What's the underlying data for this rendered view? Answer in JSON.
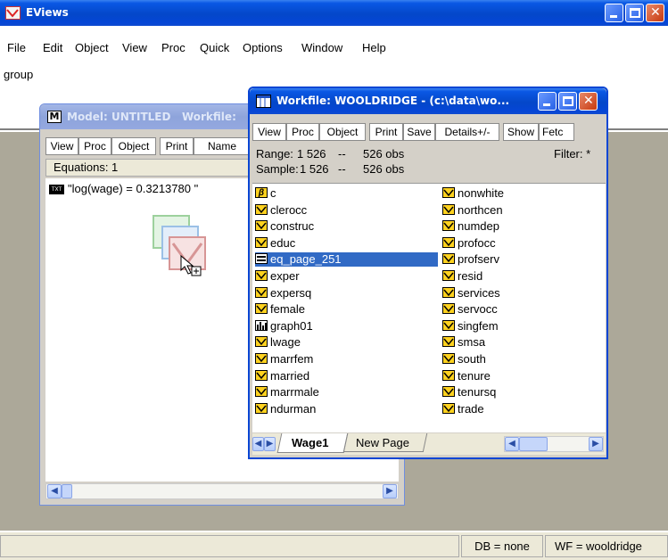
{
  "app": {
    "title": "EViews",
    "menu": [
      "File",
      "Edit",
      "Object",
      "View",
      "Proc",
      "Quick",
      "Options",
      "Window",
      "Help"
    ],
    "command_text": "group",
    "status": {
      "db": "DB = none",
      "wf": "WF = wooldridge"
    }
  },
  "model_window": {
    "title": "Model: UNTITLED   Workfile:",
    "toolbar": [
      "View",
      "Proc",
      "Object",
      "Print",
      "Name"
    ],
    "equations_label": "Equations: 1",
    "equation_text": "\"log(wage) = 0.3213780 \"",
    "equation_badge": "TXT"
  },
  "workfile_window": {
    "title": "Workfile: WOOLDRIDGE - (c:\\data\\wo...",
    "toolbar": [
      "View",
      "Proc",
      "Object",
      "Print",
      "Save",
      "Details+/-",
      "Show",
      "Fetc"
    ],
    "range_label": "Range:",
    "range_value": "1 526",
    "range_sep": "--",
    "range_obs": "526 obs",
    "sample_label": "Sample:",
    "sample_value": "1 526",
    "sample_sep": "--",
    "sample_obs": "526 obs",
    "filter": "Filter: *",
    "left_items": [
      {
        "name": "c",
        "icon": "beta-icon"
      },
      {
        "name": "clerocc",
        "icon": "series-icon"
      },
      {
        "name": "construc",
        "icon": "series-icon"
      },
      {
        "name": "educ",
        "icon": "series-icon"
      },
      {
        "name": "eq_page_251",
        "icon": "equation-icon",
        "selected": true
      },
      {
        "name": "exper",
        "icon": "series-icon"
      },
      {
        "name": "expersq",
        "icon": "series-icon"
      },
      {
        "name": "female",
        "icon": "series-icon"
      },
      {
        "name": "graph01",
        "icon": "graph-icon"
      },
      {
        "name": "lwage",
        "icon": "series-icon"
      },
      {
        "name": "marrfem",
        "icon": "series-icon"
      },
      {
        "name": "married",
        "icon": "series-icon"
      },
      {
        "name": "marrmale",
        "icon": "series-icon"
      },
      {
        "name": "ndurman",
        "icon": "series-icon"
      }
    ],
    "right_items": [
      "nonwhite",
      "northcen",
      "numdep",
      "profocc",
      "profserv",
      "resid",
      "services",
      "servocc",
      "singfem",
      "smsa",
      "south",
      "tenure",
      "tenursq",
      "trade"
    ],
    "tabs": [
      "Wage1",
      "New Page"
    ]
  },
  "colors": {
    "title_active": "#0a58e4",
    "selection": "#316ac5",
    "workspace": "#aca899"
  }
}
